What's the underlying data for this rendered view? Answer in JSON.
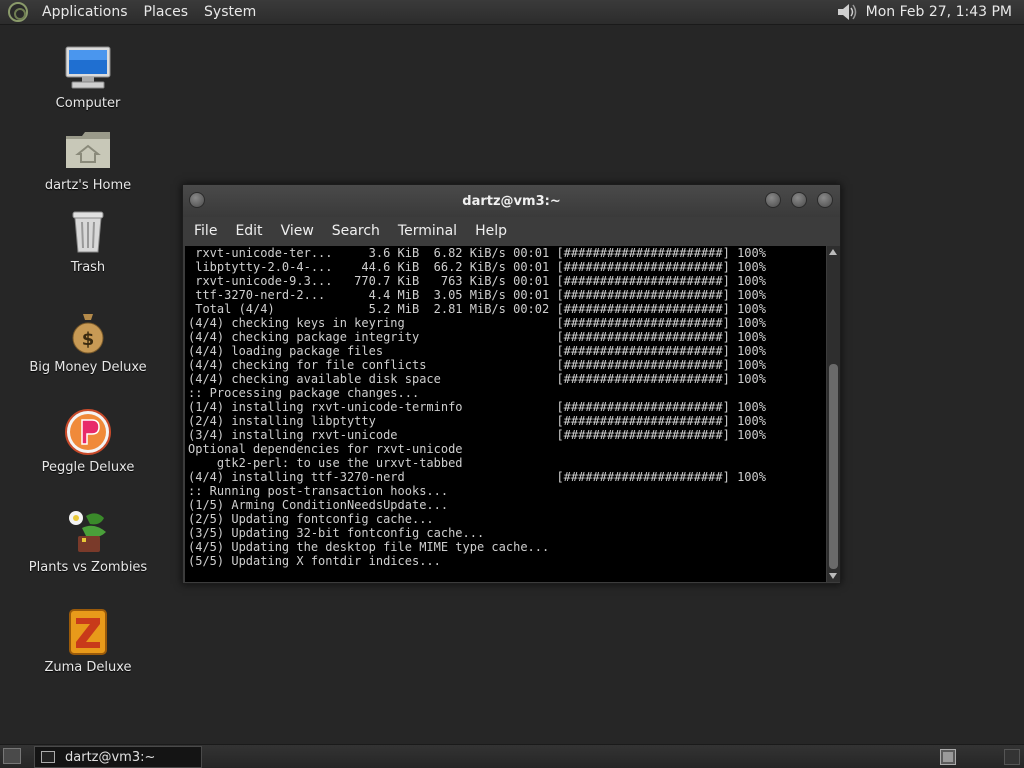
{
  "top_panel": {
    "menu": [
      "Applications",
      "Places",
      "System"
    ],
    "clock": "Mon Feb 27,  1:43 PM"
  },
  "desktop_icons": [
    {
      "label": "Computer",
      "icon": "computer-icon"
    },
    {
      "label": "dartz's Home",
      "icon": "home-folder-icon"
    },
    {
      "label": "Trash",
      "icon": "trash-icon"
    },
    {
      "label": "Big Money Deluxe",
      "icon": "money-bag-icon"
    },
    {
      "label": "Peggle Deluxe",
      "icon": "peggle-icon"
    },
    {
      "label": "Plants vs Zombies",
      "icon": "plants-icon"
    },
    {
      "label": "Zuma Deluxe",
      "icon": "zuma-icon"
    }
  ],
  "terminal": {
    "title": "dartz@vm3:~",
    "menu": [
      "File",
      "Edit",
      "View",
      "Search",
      "Terminal",
      "Help"
    ],
    "lines": [
      " rxvt-unicode-ter...     3.6 KiB  6.82 KiB/s 00:01 [######################] 100%",
      " libptytty-2.0-4-...    44.6 KiB  66.2 KiB/s 00:01 [######################] 100%",
      " rxvt-unicode-9.3...   770.7 KiB   763 KiB/s 00:01 [######################] 100%",
      " ttf-3270-nerd-2...      4.4 MiB  3.05 MiB/s 00:01 [######################] 100%",
      " Total (4/4)             5.2 MiB  2.81 MiB/s 00:02 [######################] 100%",
      "(4/4) checking keys in keyring                     [######################] 100%",
      "(4/4) checking package integrity                   [######################] 100%",
      "(4/4) loading package files                        [######################] 100%",
      "(4/4) checking for file conflicts                  [######################] 100%",
      "(4/4) checking available disk space                [######################] 100%",
      ":: Processing package changes...",
      "(1/4) installing rxvt-unicode-terminfo             [######################] 100%",
      "(2/4) installing libptytty                         [######################] 100%",
      "(3/4) installing rxvt-unicode                      [######################] 100%",
      "Optional dependencies for rxvt-unicode",
      "    gtk2-perl: to use the urxvt-tabbed",
      "(4/4) installing ttf-3270-nerd                     [######################] 100%",
      ":: Running post-transaction hooks...",
      "(1/5) Arming ConditionNeedsUpdate...",
      "(2/5) Updating fontconfig cache...",
      "(3/5) Updating 32-bit fontconfig cache...",
      "(4/5) Updating the desktop file MIME type cache...",
      "(5/5) Updating X fontdir indices..."
    ]
  },
  "taskbar": {
    "task_label": "dartz@vm3:~"
  }
}
